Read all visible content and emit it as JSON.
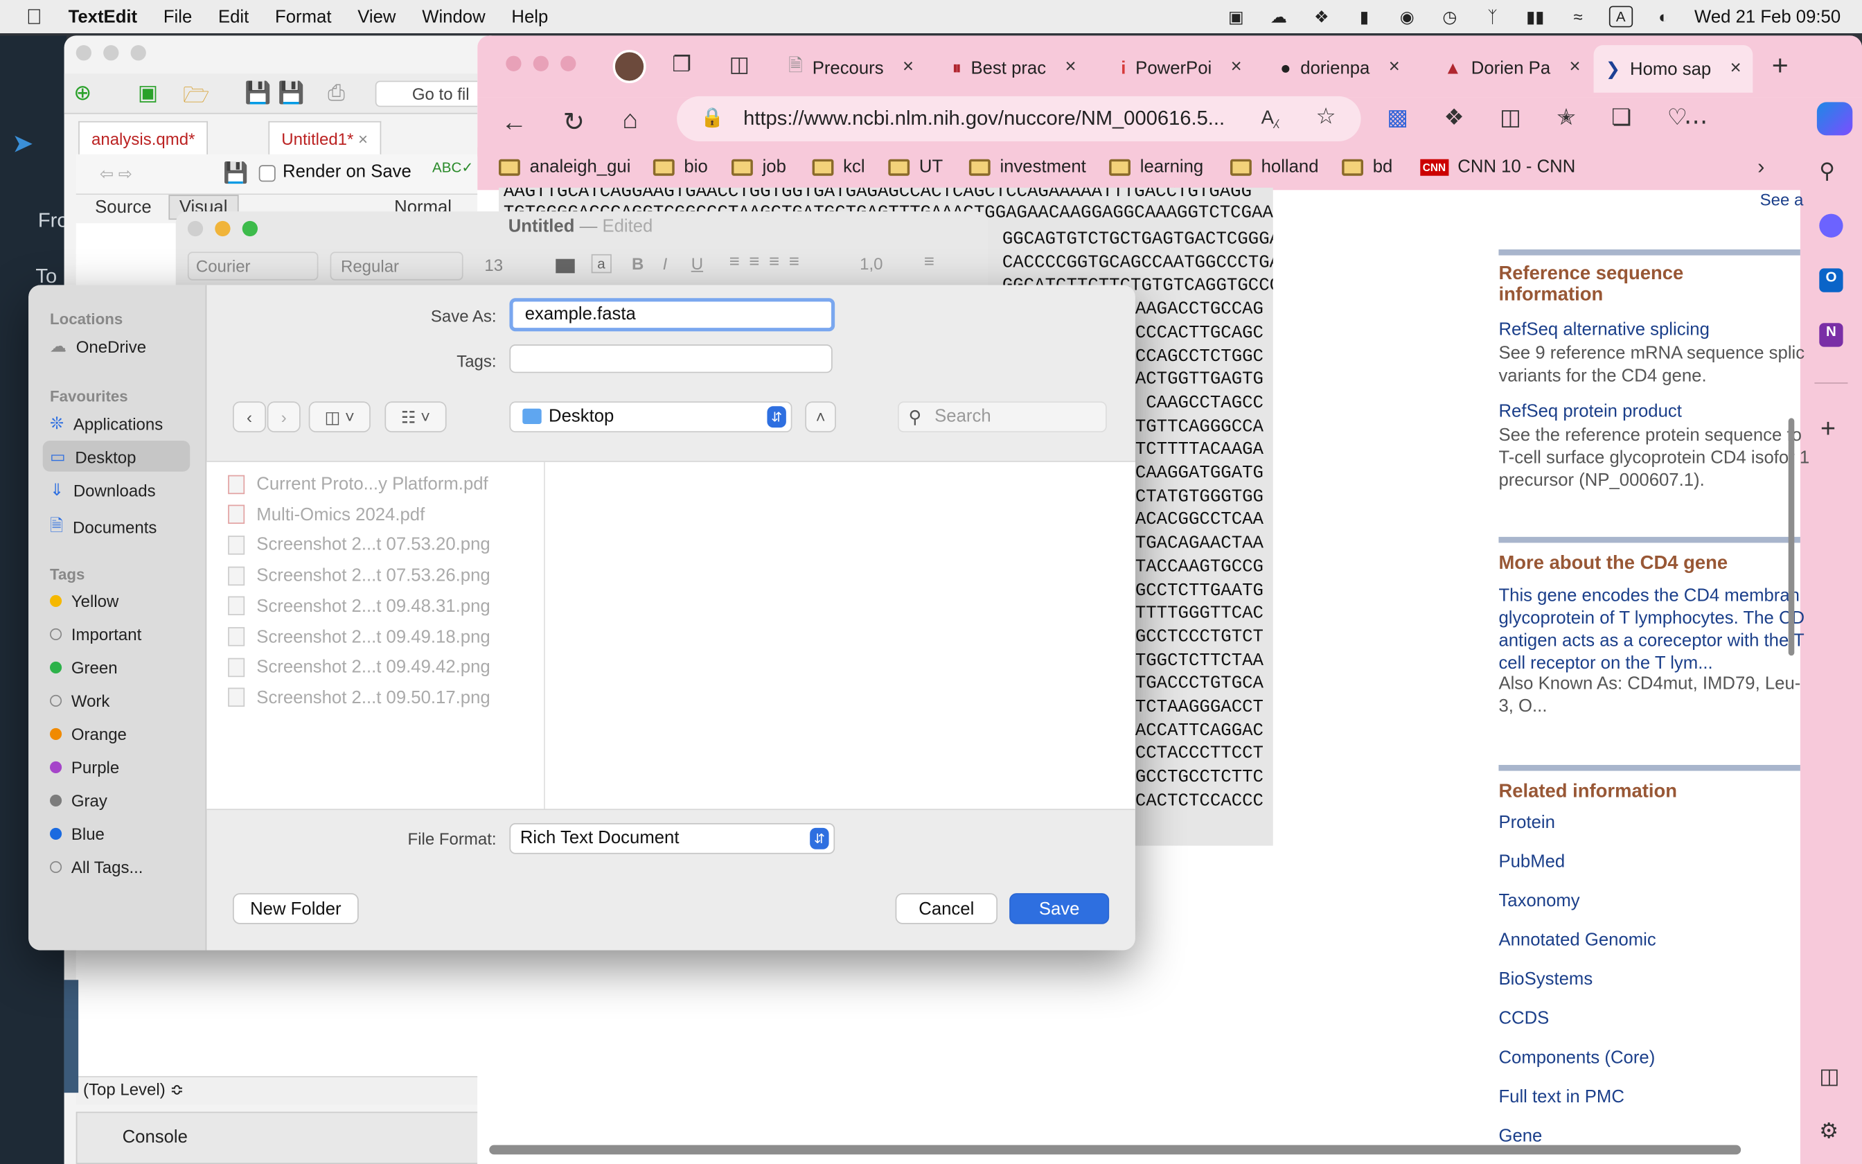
{
  "menubar": {
    "app": "TextEdit",
    "items": [
      "File",
      "Edit",
      "Format",
      "View",
      "Window",
      "Help"
    ],
    "clock": "Wed 21 Feb  09:50",
    "input_mode": "A"
  },
  "rstudio": {
    "toolbar_goto": "Go to fil",
    "tabs": [
      "analysis.qmd*",
      "Untitled1*"
    ],
    "render_on_save": "Render on Save",
    "mode_source": "Source",
    "mode_visual": "Visual",
    "style": "Normal",
    "left_frags": [
      "Fro",
      "To"
    ],
    "yaml_frag": "---",
    "top_level": "(Top Level) ≎",
    "console": "Console"
  },
  "browser": {
    "tabs": [
      {
        "label": "Precours"
      },
      {
        "label": "Best prac"
      },
      {
        "label": "PowerPoi"
      },
      {
        "label": "dorienpa"
      },
      {
        "label": "Dorien Pa"
      },
      {
        "label": "Homo sap"
      }
    ],
    "url": "https://www.ncbi.nlm.nih.gov/nuccore/NM_000616.5...",
    "bookmarks": [
      "analeigh_gui",
      "bio",
      "job",
      "kcl",
      "UT",
      "investment",
      "learning",
      "holland",
      "bd",
      "CNN 10 - CNN"
    ],
    "see_all": "See a",
    "dna_top": "AAGTTGCATCAGGAAGTGAACCTGGTGGTGATGAGAGCCACTCAGCTCCAGAAAAATTTGACCTGTGAGG",
    "dna_second": "TGTGGGGACCCAGGTCGGCCCTAAGCTGATGCTGAGTTTGAAACTGGAGAACAAGGAGGCAAAGGTCTCGAA",
    "dna_right": [
      "GGCAGTGTCTGCTGAGTGACTCGGGA",
      "CACCCCGGTGCAGCCAATGGCCCTGA",
      "GGCATCTTCTTCTGTGTCAGGTGCCG",
      "AAGACCTGCCAG",
      "CCCACTTGCAGC",
      "CCAGCCTCTGGC",
      "ACTGGTTGAGTG",
      "CAAGCCTAGCC",
      "TGTTCAGGGCCA",
      "TCTTTTACAAGA",
      "CAAGGATGGATG",
      "CTATGTGGGTGG",
      "ACACGGCCTCAA",
      "TGACAGAACTAA",
      "TACCAAGTGCCG",
      "GCCTCTTGAATG",
      "TTTTGGGTTCAC",
      "GCCTCCCTGTCT",
      "TGGCTCTTCTAA",
      "TGACCCTGTGCA",
      "TCTAAGGGACCT",
      "ACCATTCAGGAC",
      "CCTACCCTTCCT",
      "GCCTGCCTCTTC",
      "CACTCTCCACCC"
    ],
    "right_panel": {
      "refseq_heading": "Reference sequence information",
      "alt_splicing_link": "RefSeq alternative splicing",
      "alt_splicing_desc": "See 9 reference mRNA sequence splic variants for the CD4 gene.",
      "protein_product_link": "RefSeq protein product",
      "protein_product_desc": "See the reference protein sequence fo T-cell surface glycoprotein CD4 isofor 1 precursor (NP_000607.1).",
      "more_about_heading": "More about the CD4 gene",
      "more_about_desc": "This gene encodes the CD4 membran glycoprotein of T lymphocytes. The CD antigen acts as a coreceptor with the T cell receptor on the T lym...",
      "aka": "Also Known As: CD4mut, IMD79, Leu-3, O...",
      "related_heading": "Related information",
      "related_links": [
        "Protein",
        "PubMed",
        "Taxonomy",
        "Annotated Genomic",
        "BioSystems",
        "CCDS",
        "Components (Core)",
        "Full text in PMC",
        "Gene"
      ]
    }
  },
  "textedit": {
    "title": "Untitled",
    "edited": "Edited",
    "font": "Courier",
    "style": "Regular",
    "size": "13",
    "spacing": "1,0"
  },
  "save_dialog": {
    "save_as_label": "Save As:",
    "save_as_value": "example.fasta",
    "tags_label": "Tags:",
    "location": "Desktop",
    "search_placeholder": "Search",
    "sidebar": {
      "locations_heading": "Locations",
      "locations": [
        "OneDrive"
      ],
      "favourites_heading": "Favourites",
      "favourites": [
        "Applications",
        "Desktop",
        "Downloads",
        "Documents"
      ],
      "tags_heading": "Tags",
      "tags": [
        {
          "name": "Yellow",
          "color": "#f5b800"
        },
        {
          "name": "Important",
          "color": ""
        },
        {
          "name": "Green",
          "color": "#2db24a"
        },
        {
          "name": "Work",
          "color": ""
        },
        {
          "name": "Orange",
          "color": "#f08a00"
        },
        {
          "name": "Purple",
          "color": "#a545c9"
        },
        {
          "name": "Gray",
          "color": "#7c7c7c"
        },
        {
          "name": "Blue",
          "color": "#1a6ae0"
        },
        {
          "name": "All Tags...",
          "color": ""
        }
      ]
    },
    "files": [
      "Current Proto...y Platform.pdf",
      "Multi-Omics 2024.pdf",
      "Screenshot 2...t 07.53.20.png",
      "Screenshot 2...t 07.53.26.png",
      "Screenshot 2...t 09.48.31.png",
      "Screenshot 2...t 09.49.18.png",
      "Screenshot 2...t 09.49.42.png",
      "Screenshot 2...t 09.50.17.png"
    ],
    "file_format_label": "File Format:",
    "file_format_value": "Rich Text Document",
    "new_folder": "New Folder",
    "cancel": "Cancel",
    "save": "Save"
  },
  "colors": {
    "browser_chrome": "#f7c9da",
    "accent_blue": "#2e6fe0",
    "ncbi_heading": "#985735",
    "ncbi_link": "#1b3f8a"
  }
}
